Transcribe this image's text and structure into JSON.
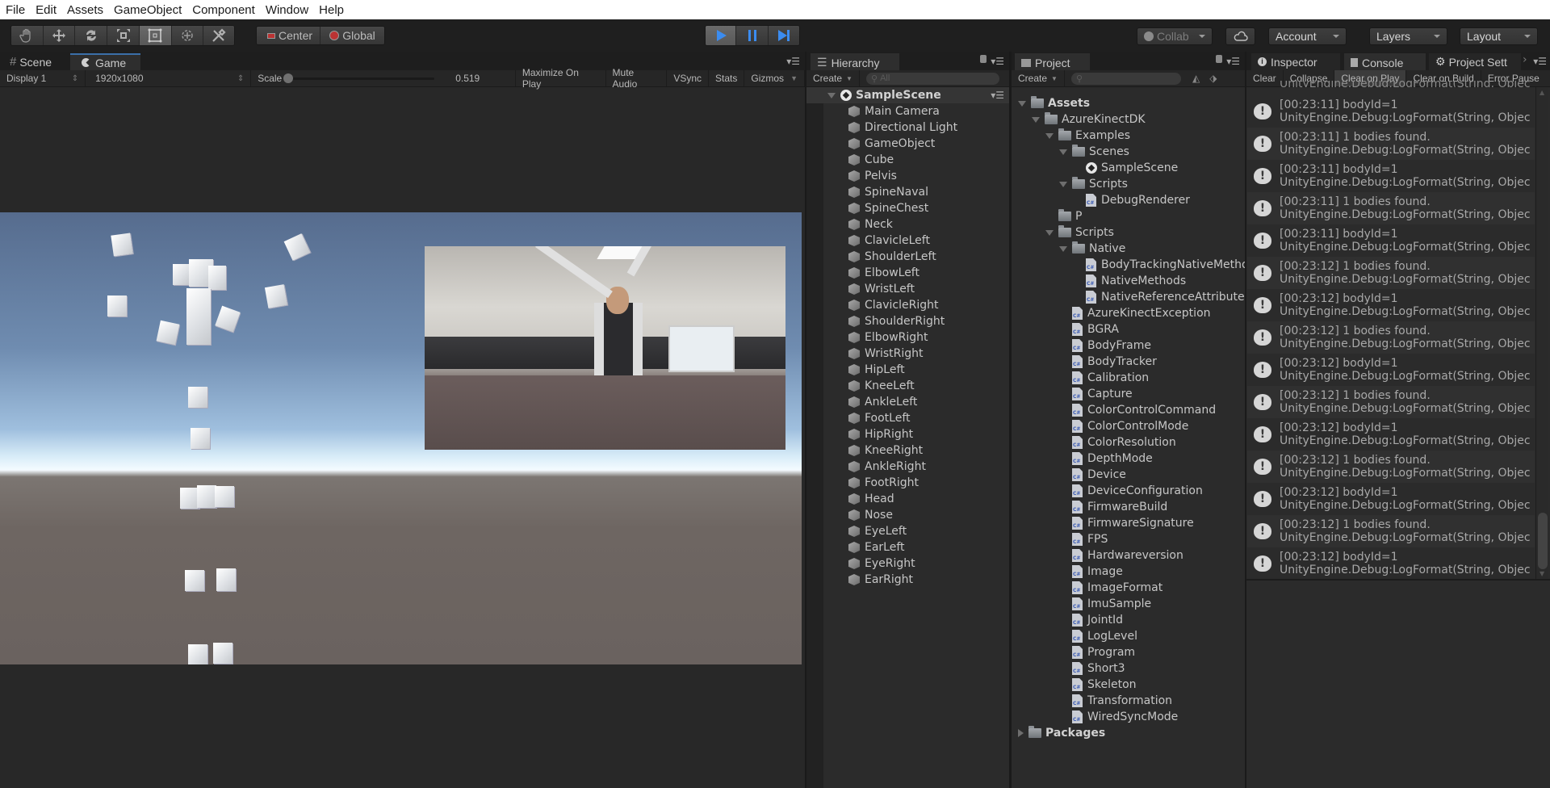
{
  "menu": [
    "File",
    "Edit",
    "Assets",
    "GameObject",
    "Component",
    "Window",
    "Help"
  ],
  "toolbar": {
    "tools": [
      {
        "name": "hand-tool",
        "icon": "hand-icon",
        "active": false
      },
      {
        "name": "move-tool",
        "icon": "move-icon",
        "active": false
      },
      {
        "name": "rotate-tool",
        "icon": "rotate-icon",
        "active": false
      },
      {
        "name": "scale-tool",
        "icon": "scale-icon",
        "active": false
      },
      {
        "name": "rect-tool",
        "icon": "rect-icon",
        "active": true
      },
      {
        "name": "transform-tool",
        "icon": "transform-icon",
        "active": false
      },
      {
        "name": "custom-tool",
        "icon": "tools-icon",
        "active": false
      }
    ],
    "pivot_label": "Center",
    "space_label": "Global",
    "collab_label": "Collab",
    "account_label": "Account",
    "layers_label": "Layers",
    "layout_label": "Layout",
    "play_accent": "#3b8cf0"
  },
  "game_panel": {
    "tabs": [
      {
        "label": "Scene",
        "icon": "grid-icon"
      },
      {
        "label": "Game",
        "icon": "pacman-icon"
      }
    ],
    "display": "Display 1",
    "resolution": "1920x1080",
    "scale_label": "Scale",
    "scale_value": "0.519",
    "buttons": [
      "Maximize On Play",
      "Mute Audio",
      "VSync",
      "Stats",
      "Gizmos"
    ]
  },
  "hierarchy": {
    "title": "Hierarchy",
    "create_label": "Create",
    "search_placeholder": "All",
    "scene_name": "SampleScene",
    "items": [
      "Main Camera",
      "Directional Light",
      "GameObject",
      "Cube",
      "Pelvis",
      "SpineNaval",
      "SpineChest",
      "Neck",
      "ClavicleLeft",
      "ShoulderLeft",
      "ElbowLeft",
      "WristLeft",
      "ClavicleRight",
      "ShoulderRight",
      "ElbowRight",
      "WristRight",
      "HipLeft",
      "KneeLeft",
      "AnkleLeft",
      "FootLeft",
      "HipRight",
      "KneeRight",
      "AnkleRight",
      "FootRight",
      "Head",
      "Nose",
      "EyeLeft",
      "EarLeft",
      "EyeRight",
      "EarRight"
    ]
  },
  "project": {
    "title": "Project",
    "create_label": "Create",
    "search_placeholder": "",
    "tree": [
      {
        "label": "Assets",
        "type": "folder",
        "depth": 0,
        "expanded": true,
        "bold": true
      },
      {
        "label": "AzureKinectDK",
        "type": "folder",
        "depth": 1,
        "expanded": true
      },
      {
        "label": "Examples",
        "type": "folder",
        "depth": 2,
        "expanded": true
      },
      {
        "label": "Scenes",
        "type": "folder",
        "depth": 3,
        "expanded": true
      },
      {
        "label": "SampleScene",
        "type": "scene",
        "depth": 4
      },
      {
        "label": "Scripts",
        "type": "folder",
        "depth": 3,
        "expanded": true
      },
      {
        "label": "DebugRenderer",
        "type": "script",
        "depth": 4
      },
      {
        "label": "P",
        "type": "folder",
        "depth": 2
      },
      {
        "label": "Scripts",
        "type": "folder",
        "depth": 2,
        "expanded": true
      },
      {
        "label": "Native",
        "type": "folder",
        "depth": 3,
        "expanded": true
      },
      {
        "label": "BodyTrackingNativeMethods",
        "type": "script",
        "depth": 4
      },
      {
        "label": "NativeMethods",
        "type": "script",
        "depth": 4
      },
      {
        "label": "NativeReferenceAttribute",
        "type": "script",
        "depth": 4
      },
      {
        "label": "AzureKinectException",
        "type": "script",
        "depth": 3
      },
      {
        "label": "BGRA",
        "type": "script",
        "depth": 3
      },
      {
        "label": "BodyFrame",
        "type": "script",
        "depth": 3
      },
      {
        "label": "BodyTracker",
        "type": "script",
        "depth": 3
      },
      {
        "label": "Calibration",
        "type": "script",
        "depth": 3
      },
      {
        "label": "Capture",
        "type": "script",
        "depth": 3
      },
      {
        "label": "ColorControlCommand",
        "type": "script",
        "depth": 3
      },
      {
        "label": "ColorControlMode",
        "type": "script",
        "depth": 3
      },
      {
        "label": "ColorResolution",
        "type": "script",
        "depth": 3
      },
      {
        "label": "DepthMode",
        "type": "script",
        "depth": 3
      },
      {
        "label": "Device",
        "type": "script",
        "depth": 3
      },
      {
        "label": "DeviceConfiguration",
        "type": "script",
        "depth": 3
      },
      {
        "label": "FirmwareBuild",
        "type": "script",
        "depth": 3
      },
      {
        "label": "FirmwareSignature",
        "type": "script",
        "depth": 3
      },
      {
        "label": "FPS",
        "type": "script",
        "depth": 3
      },
      {
        "label": "Hardwareversion",
        "type": "script",
        "depth": 3
      },
      {
        "label": "Image",
        "type": "script",
        "depth": 3
      },
      {
        "label": "ImageFormat",
        "type": "script",
        "depth": 3
      },
      {
        "label": "ImuSample",
        "type": "script",
        "depth": 3
      },
      {
        "label": "JointId",
        "type": "script",
        "depth": 3
      },
      {
        "label": "LogLevel",
        "type": "script",
        "depth": 3
      },
      {
        "label": "Program",
        "type": "script",
        "depth": 3
      },
      {
        "label": "Short3",
        "type": "script",
        "depth": 3
      },
      {
        "label": "Skeleton",
        "type": "script",
        "depth": 3
      },
      {
        "label": "Transformation",
        "type": "script",
        "depth": 3
      },
      {
        "label": "WiredSyncMode",
        "type": "script",
        "depth": 3
      },
      {
        "label": "Packages",
        "type": "folder",
        "depth": 0,
        "expanded": false,
        "bold": true
      }
    ]
  },
  "console": {
    "tabs": [
      {
        "label": "Inspector",
        "icon": "info-icon"
      },
      {
        "label": "Console",
        "icon": "console-icon"
      },
      {
        "label": "Project Sett",
        "icon": "gear-icon"
      }
    ],
    "toolbar": [
      "Clear",
      "Collapse",
      "Clear on Play",
      "Clear on Build",
      "Error Pause"
    ],
    "partial_top_line": "UnityEngine.Debug:LogFormat(String, Objec",
    "entries": [
      {
        "message": "[00:23:11] bodyId=1",
        "trace": "UnityEngine.Debug:LogFormat(String, Objec"
      },
      {
        "message": "[00:23:11] 1 bodies found.",
        "trace": "UnityEngine.Debug:LogFormat(String, Objec"
      },
      {
        "message": "[00:23:11] bodyId=1",
        "trace": "UnityEngine.Debug:LogFormat(String, Objec"
      },
      {
        "message": "[00:23:11] 1 bodies found.",
        "trace": "UnityEngine.Debug:LogFormat(String, Objec"
      },
      {
        "message": "[00:23:11] bodyId=1",
        "trace": "UnityEngine.Debug:LogFormat(String, Objec"
      },
      {
        "message": "[00:23:12] 1 bodies found.",
        "trace": "UnityEngine.Debug:LogFormat(String, Objec"
      },
      {
        "message": "[00:23:12] bodyId=1",
        "trace": "UnityEngine.Debug:LogFormat(String, Objec"
      },
      {
        "message": "[00:23:12] 1 bodies found.",
        "trace": "UnityEngine.Debug:LogFormat(String, Objec"
      },
      {
        "message": "[00:23:12] bodyId=1",
        "trace": "UnityEngine.Debug:LogFormat(String, Objec"
      },
      {
        "message": "[00:23:12] 1 bodies found.",
        "trace": "UnityEngine.Debug:LogFormat(String, Objec"
      },
      {
        "message": "[00:23:12] bodyId=1",
        "trace": "UnityEngine.Debug:LogFormat(String, Objec"
      },
      {
        "message": "[00:23:12] 1 bodies found.",
        "trace": "UnityEngine.Debug:LogFormat(String, Objec"
      },
      {
        "message": "[00:23:12] bodyId=1",
        "trace": "UnityEngine.Debug:LogFormat(String, Objec"
      },
      {
        "message": "[00:23:12] 1 bodies found.",
        "trace": "UnityEngine.Debug:LogFormat(String, Objec"
      },
      {
        "message": "[00:23:12] bodyId=1",
        "trace": "UnityEngine.Debug:LogFormat(String, Objec"
      }
    ]
  }
}
